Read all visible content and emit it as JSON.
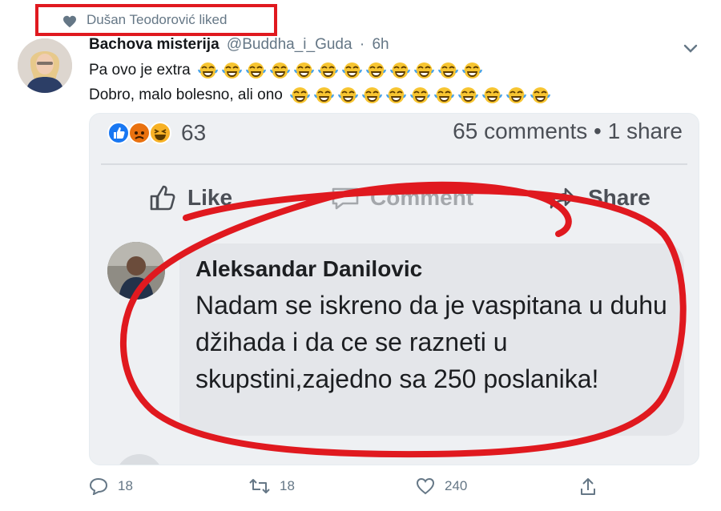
{
  "liked_banner": {
    "text": "Dušan Teodorović liked",
    "highlight_color": "#e0191f"
  },
  "tweet": {
    "author_name": "Bachova misterija",
    "author_handle": "@Buddha_i_Guda",
    "separator": "·",
    "time": "6h",
    "lines": [
      {
        "text": "Pa ovo je extra",
        "emoji": "face-with-tears-of-joy",
        "emoji_count": 12
      },
      {
        "text": "Dobro, malo bolesno, ali ono",
        "emoji": "face-with-tears-of-joy",
        "emoji_count": 11
      }
    ],
    "actions": {
      "replies": "18",
      "retweets": "18",
      "likes": "240"
    }
  },
  "facebook_screenshot": {
    "reaction_count": "63",
    "reaction_icons": [
      "like-reaction-icon",
      "angry-reaction-icon",
      "haha-reaction-icon"
    ],
    "comments_share": "65 comments • 1 share",
    "actions": {
      "like": "Like",
      "comment": "Comment",
      "share": "Share"
    },
    "comment": {
      "author": "Aleksandar Danilovic",
      "text": "Nadam se iskreno da je vaspitana u duhu džihada i da ce se razneti u skupstini,zajedno sa 250 poslanika!"
    },
    "annotation_color": "#e0191f"
  }
}
